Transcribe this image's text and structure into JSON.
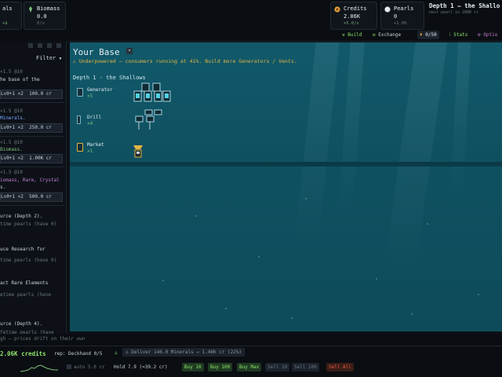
{
  "top": {
    "res1": {
      "label": "als",
      "rate": "+$"
    },
    "biomass": {
      "label": "Biomass",
      "value": "0.0",
      "rate": "0/s",
      "icon": "biomass-icon"
    },
    "credits": {
      "label": "Credits",
      "value": "2.06K",
      "rate": "+5.0/s",
      "icon": "coin-icon"
    },
    "pearls": {
      "label": "Pearls",
      "value": "0",
      "rate": "+1.00",
      "icon": "pearl-icon"
    },
    "depth_title": "Depth 1 — the Shallo",
    "depth_sub": "next pearl in 200K cr"
  },
  "toolbar": {
    "build": "Build",
    "exchange": "Exchange",
    "pearl_count": "0/50",
    "stats": "Stats",
    "options": "Optio"
  },
  "left": {
    "filter": "Filter",
    "lines": [
      {
        "text": "×1.5 @10",
        "color": "#6b7682"
      },
      {
        "text": "he base of the",
        "color": "#c9d1d9"
      },
      {
        "buy": "Lv0+1 ×2  100.0 cr"
      },
      {
        "text": "×1.5 @10",
        "color": "#6b7682"
      },
      {
        "text": "Minerals.",
        "color": "#7aa7ff"
      },
      {
        "buy": "Lv0+1 ×2  250.0 cr"
      },
      {
        "text": "×1.5 @10",
        "color": "#6b7682"
      },
      {
        "text": "Biomass.",
        "color": "#7ec27e"
      },
      {
        "buy": "Lv0+1 ×2  1.00K cr"
      },
      {
        "text": "×1.5 @10",
        "color": "#6b7682"
      },
      {
        "text": "iomass, Rare, Crystal",
        "color": "#c77dd6"
      },
      {
        "text": "s.",
        "color": "#c9d1d9"
      },
      {
        "buy": "Lv0+1 ×2  500.0 cr"
      },
      {
        "text": "urce (Depth 2).",
        "color": "#c9d1d9"
      },
      {
        "text": "time pearls (have 0)",
        "color": "#6b7682"
      },
      {
        "text": "uce Research for",
        "color": "#c9d1d9"
      },
      {
        "text": "time pearls (have 0)",
        "color": "#6b7682"
      },
      {
        "text": "act Rare Elements",
        "color": "#c9d1d9"
      },
      {
        "text": "etime pearls (have",
        "color": "#6b7682"
      },
      {
        "text": "urce (Depth 4).",
        "color": "#c9d1d9"
      },
      {
        "text": "fetime pearls (have",
        "color": "#6b7682"
      }
    ]
  },
  "base": {
    "title": "Your Base",
    "warning": "⚠ Underpowered — consumers running at 41%. Build more Generators / Vents.",
    "depth_label": "Depth 1 - the Shallows",
    "units": [
      {
        "name": "Generator",
        "count": "×5",
        "icon": "generator-icon"
      },
      {
        "name": "Drill",
        "count": "×4",
        "icon": "drill-icon"
      },
      {
        "name": "Market",
        "count": "×1",
        "icon": "market-icon"
      }
    ]
  },
  "bottom": {
    "ticker": "gh — prices drift on their own",
    "credits": "2.06K credits",
    "rep": "rep: Deckhand 0/5",
    "deliver": "⚓ Deliver 146.0 Minerals → 1.46K cr (22%)",
    "auto": "auto 5.0 cr",
    "hold": "Hold 7.9  (≈39.2 cr)",
    "buttons": [
      "Buy 10",
      "Buy 100",
      "Buy Max",
      "Sell 10",
      "Sell 100",
      "Sell All"
    ]
  },
  "colors": {
    "warning": "#e3b341",
    "accent": "#8fe36b",
    "sell_all": "#e05a3a"
  }
}
